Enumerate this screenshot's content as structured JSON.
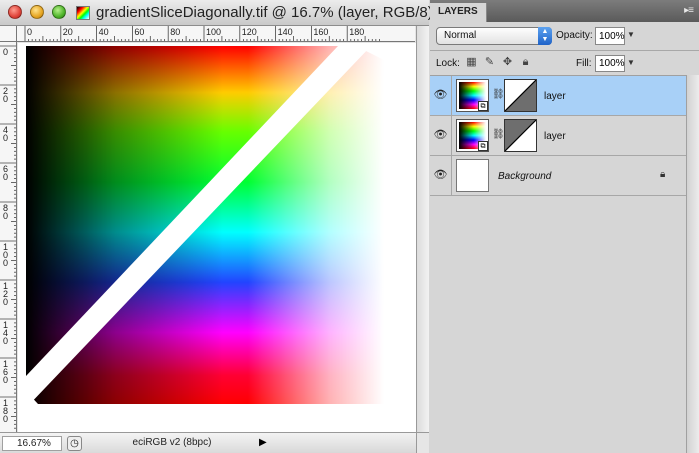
{
  "document": {
    "title": "gradientSliceDiagonally.tif @ 16.7% (layer, RGB/8)",
    "ruler_top_labels": [
      "0",
      "20",
      "40",
      "60",
      "80",
      "100",
      "120",
      "140",
      "160",
      "180"
    ],
    "ruler_left_labels": [
      "0",
      "2\n0",
      "4\n0",
      "6\n0",
      "8\n0",
      "1\n0\n0",
      "1\n2\n0",
      "1\n4\n0",
      "1\n6\n0",
      "1\n8\n0"
    ],
    "zoom": "16.67%",
    "status_info": "eciRGB v2 (8bpc)"
  },
  "panel": {
    "tab": "LAYERS",
    "blend_mode": "Normal",
    "opacity_label": "Opacity:",
    "opacity_value": "100%",
    "lock_label": "Lock:",
    "fill_label": "Fill:",
    "fill_value": "100%",
    "layers": [
      {
        "name": "layer",
        "selected": true,
        "visible": true
      },
      {
        "name": "layer",
        "selected": false,
        "visible": true
      },
      {
        "name": "Background",
        "selected": false,
        "visible": true,
        "locked": true
      }
    ]
  },
  "icons": {
    "window_close": "close-icon",
    "window_minimize": "minimize-icon",
    "window_zoom": "zoom-icon",
    "visibility": "eye-icon",
    "lock_transparent": "lock-transparent-pixels-icon",
    "lock_image": "brush-icon",
    "lock_position": "move-icon",
    "lock_all": "lock-icon",
    "link": "link-icon",
    "smart_object": "smart-object-icon"
  },
  "colors": {
    "selection": "#a8d0f7",
    "panel_bg": "#d6d6d6",
    "tab_bar": "#6a6a6a"
  }
}
